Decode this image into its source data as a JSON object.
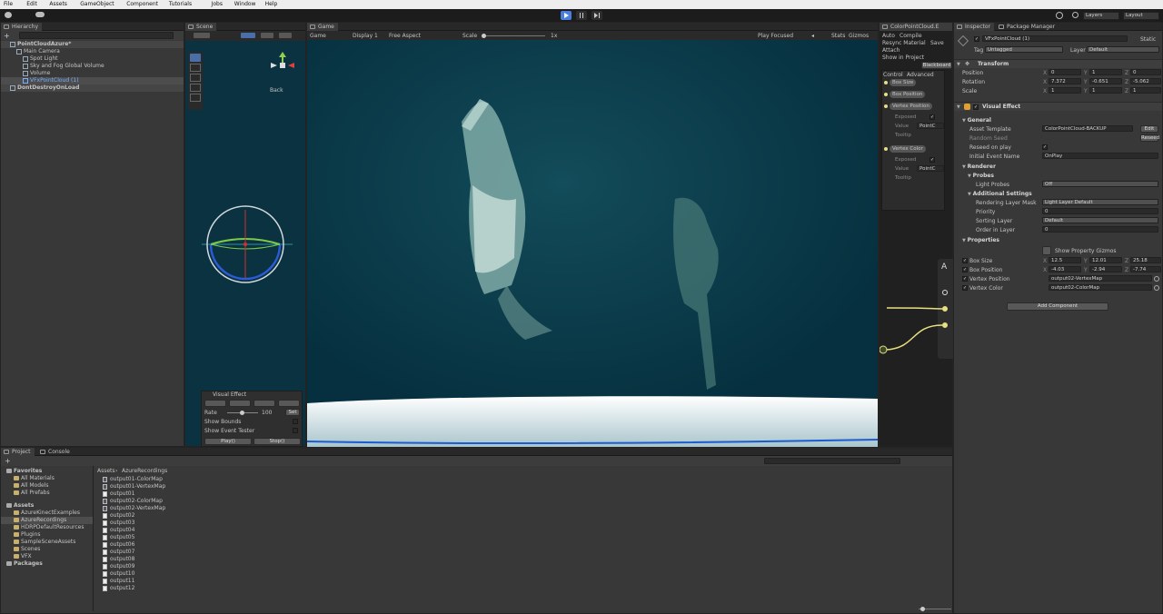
{
  "menu": [
    "File",
    "Edit",
    "Assets",
    "GameObject",
    "Component",
    "Tutorials",
    "Jobs",
    "Window",
    "Help"
  ],
  "toolbar": {
    "layers": "Layers",
    "layout": "Layout",
    "colors": {
      "play_active": "#4a7fe0"
    }
  },
  "hierarchy": {
    "tab": "Hierarchy",
    "items": [
      {
        "label": "PointCloudAzure*",
        "depth": 0,
        "bold": true
      },
      {
        "label": "Main Camera",
        "depth": 1
      },
      {
        "label": "Spot Light",
        "depth": 2
      },
      {
        "label": "Sky and Fog Global Volume",
        "depth": 2
      },
      {
        "label": "Volume",
        "depth": 2
      },
      {
        "label": "VFxPointCloud (1)",
        "depth": 2,
        "selected": true
      },
      {
        "label": "DontDestroyOnLoad",
        "depth": 0,
        "bold": true
      }
    ]
  },
  "scene": {
    "tab": "Scene",
    "gizmo_label": "Back",
    "vfx_panel": {
      "title": "Visual Effect",
      "rate_label": "Rate",
      "rate_value": "100",
      "set_button": "Set",
      "show_bounds": "Show Bounds",
      "show_event_tester": "Show Event Tester",
      "play_button": "Play()",
      "stop_button": "Stop()"
    }
  },
  "game": {
    "tab": "Game",
    "display": "Display 1",
    "aspect": "Free Aspect",
    "scale_label": "Scale",
    "scale_value": "1x",
    "play_focused": "Play Focused",
    "stats": "Stats",
    "gizmos": "Gizmos",
    "colors": {
      "bg": "#06303f",
      "floor": "#e6eef0"
    }
  },
  "vfx_graph": {
    "tab": "ColorPointCloud.E",
    "toolbar": [
      "Auto",
      "Compile"
    ],
    "resync": "Resync Material",
    "save": "Save",
    "attach": "Attach",
    "show_in_project": "Show in Project",
    "blackboard": "Blackboard",
    "control": "Control",
    "advanced": "Advanced",
    "nodes": [
      {
        "label": "Box Size"
      },
      {
        "label": "Box Position"
      },
      {
        "label": "Vertex Position",
        "sub": [
          "Exposed",
          "Value",
          "Tooltip"
        ],
        "value": "PointC"
      },
      {
        "label": "Vertex Color",
        "sub": [
          "Exposed",
          "Value",
          "Tooltip"
        ],
        "value": "PointC"
      }
    ]
  },
  "inspector": {
    "tabs": [
      "Inspector",
      "Package Manager"
    ],
    "object_name": "VFxPointCloud (1)",
    "static": "Static",
    "tag_label": "Tag",
    "tag_value": "Untagged",
    "layer_label": "Layer",
    "layer_value": "Default",
    "transform": {
      "title": "Transform",
      "rows": [
        {
          "label": "Position",
          "x": "0",
          "y": "1",
          "z": "0"
        },
        {
          "label": "Rotation",
          "x": "7.372",
          "y": "-0.651",
          "z": "-5.062"
        },
        {
          "label": "Scale",
          "x": "1",
          "y": "1",
          "z": "1"
        }
      ]
    },
    "visual_effect": {
      "title": "Visual Effect",
      "general": "General",
      "asset_template_label": "Asset Template",
      "asset_template_value": "ColorPointCloud-BACKUP",
      "edit_button": "Edit",
      "random_seed": "Random Seed",
      "reseed_label": "Reseed",
      "reseed_on_play": "Reseed on play",
      "initial_event_label": "Initial Event Name",
      "initial_event_value": "OnPlay",
      "renderer": "Renderer",
      "probes": "Probes",
      "light_probes_label": "Light Probes",
      "light_probes_value": "Off",
      "additional": "Additional Settings",
      "rendering_layer_label": "Rendering Layer Mask",
      "rendering_layer_value": "Light Layer Default",
      "priority_label": "Priority",
      "priority_value": "0",
      "sorting_layer_label": "Sorting Layer",
      "sorting_layer_value": "Default",
      "order_label": "Order in Layer",
      "order_value": "0",
      "properties": "Properties",
      "show_gizmos": "Show Property Gizmos",
      "box_size": {
        "label": "Box Size",
        "x": "12.5",
        "y": "12.01",
        "z": "25.18"
      },
      "box_position": {
        "label": "Box Position",
        "x": "-4.03",
        "y": "-2.94",
        "z": "-7.74"
      },
      "vertex_position": {
        "label": "Vertex Position",
        "value": "output02-VertexMap"
      },
      "vertex_color": {
        "label": "Vertex Color",
        "value": "output02-ColorMap"
      }
    },
    "add_component": "Add Component"
  },
  "project": {
    "tabs": [
      "Project",
      "Console"
    ],
    "favorites": "Favorites",
    "fav_items": [
      "All Materials",
      "All Models",
      "All Prefabs"
    ],
    "assets": "Assets",
    "asset_items": [
      "AzureKinectExamples",
      "AzureRecordings",
      "HDRPDefaultResources",
      "Plugins",
      "SampleSceneAssets",
      "Scenes",
      "VFX"
    ],
    "packages": "Packages",
    "breadcrumb": [
      "Assets",
      "AzureRecordings"
    ],
    "files": [
      "output01-ColorMap",
      "output01-VertexMap",
      "output01",
      "output02-ColorMap",
      "output02-VertexMap",
      "output02",
      "output03",
      "output04",
      "output05",
      "output06",
      "output07",
      "output08",
      "output09",
      "output10",
      "output11",
      "output12"
    ]
  }
}
